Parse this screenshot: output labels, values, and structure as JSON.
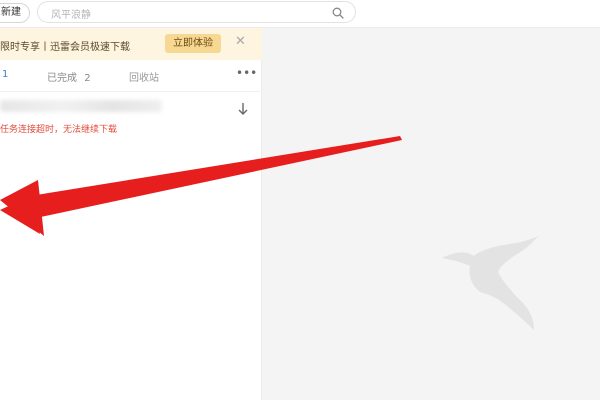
{
  "toolbar": {
    "new_label": "新建",
    "search_placeholder": "风平浪静",
    "search_icon": "search-icon"
  },
  "promo": {
    "text": "限时专享丨迅雷会员极速下载",
    "button_label": "立即体验",
    "close_icon": "close-icon",
    "background": "#fdf5e0",
    "button_color": "#f6d893"
  },
  "tabs": {
    "downloading_count": "1",
    "completed_label": "已完成",
    "completed_count": "2",
    "recycle_label": "回收站",
    "more_icon": "more-icon",
    "active_color": "#3a7fd9"
  },
  "task": {
    "error_text": "任务连接超时，无法继续下载",
    "error_color": "#e24a3b",
    "action_icon": "download-arrow-icon"
  },
  "right_panel": {
    "logo": "hummingbird-logo",
    "background": "#f4f4f4"
  },
  "annotation": {
    "arrow_color": "#e61e1e",
    "icon": "red-arrow-icon"
  }
}
